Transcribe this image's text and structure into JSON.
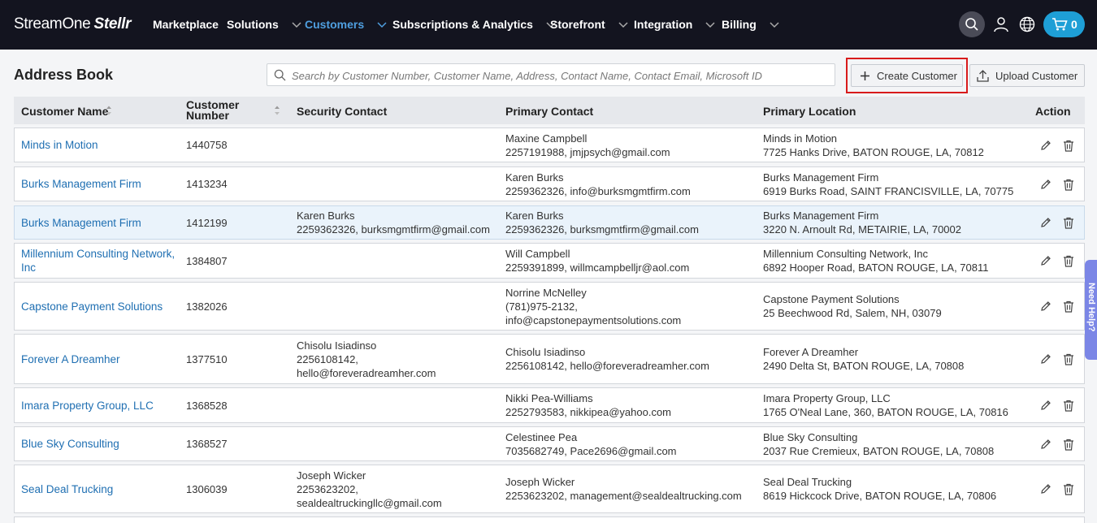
{
  "nav": {
    "brand_main": "StreamOne",
    "brand_sub": "Stellr",
    "items": [
      {
        "label": "Marketplace",
        "has_menu": false
      },
      {
        "label": "Solutions",
        "has_menu": true
      },
      {
        "label": "Customers",
        "has_menu": true,
        "active": true
      },
      {
        "label": "Subscriptions & Analytics",
        "has_menu": true
      },
      {
        "label": "Storefront",
        "has_menu": true
      },
      {
        "label": "Integration",
        "has_menu": true
      },
      {
        "label": "Billing",
        "has_menu": true
      }
    ],
    "cart_count": "0",
    "icons": [
      "search-icon",
      "user-icon",
      "globe-icon",
      "cart-icon"
    ]
  },
  "page": {
    "title": "Address Book",
    "search_placeholder": "Search by Customer Number, Customer Name, Address, Contact Name, Contact Email, Microsoft ID",
    "create_label": "Create Customer",
    "upload_label": "Upload Customer"
  },
  "table": {
    "columns": {
      "name": "Customer Name",
      "number_l1": "Customer",
      "number_l2": "Number",
      "security": "Security Contact",
      "primary": "Primary Contact",
      "location": "Primary Location",
      "action": "Action"
    },
    "rows": [
      {
        "name": [
          "Minds in Motion"
        ],
        "number": "1440758",
        "security": [],
        "primary": [
          "Maxine Campbell",
          "2257191988, jmjpsych@gmail.com"
        ],
        "location": [
          "Minds in Motion",
          "7725 Hanks Drive, BATON ROUGE, LA, 70812"
        ]
      },
      {
        "name": [
          "Burks Management Firm"
        ],
        "number": "1413234",
        "security": [],
        "primary": [
          "Karen Burks",
          "2259362326, info@burksmgmtfirm.com"
        ],
        "location": [
          "Burks Management Firm",
          "6919 Burks Road, SAINT FRANCISVILLE, LA, 70775"
        ]
      },
      {
        "name": [
          "Burks Management Firm"
        ],
        "number": "1412199",
        "security": [
          "Karen Burks",
          "2259362326, burksmgmtfirm@gmail.com"
        ],
        "primary": [
          "Karen Burks",
          "2259362326, burksmgmtfirm@gmail.com"
        ],
        "location": [
          "Burks Management Firm",
          "3220 N. Arnoult Rd, METAIRIE, LA, 70002"
        ],
        "selected": true
      },
      {
        "name": [
          "Millennium Consulting Network,",
          "Inc"
        ],
        "number": "1384807",
        "security": [],
        "primary": [
          "Will Campbell",
          "2259391899, willmcampbelljr@aol.com"
        ],
        "location": [
          "Millennium Consulting Network, Inc",
          "6892 Hooper Road, BATON ROUGE, LA, 70811"
        ]
      },
      {
        "name": [
          "Capstone Payment Solutions"
        ],
        "number": "1382026",
        "security": [],
        "primary": [
          "Norrine McNelley",
          "(781)975-2132,",
          "info@capstonepaymentsolutions.com"
        ],
        "location": [
          "Capstone Payment Solutions",
          "25 Beechwood Rd, Salem, NH, 03079"
        ]
      },
      {
        "name": [
          "Forever A Dreamher"
        ],
        "number": "1377510",
        "security": [
          "Chisolu Isiadinso",
          "2256108142,",
          "hello@foreveradreamher.com"
        ],
        "primary": [
          "Chisolu Isiadinso",
          "2256108142, hello@foreveradreamher.com"
        ],
        "location": [
          "Forever A Dreamher",
          "2490 Delta St, BATON ROUGE, LA, 70808"
        ]
      },
      {
        "name": [
          "Imara Property Group, LLC"
        ],
        "number": "1368528",
        "security": [],
        "primary": [
          "Nikki Pea-Williams",
          "2252793583, nikkipea@yahoo.com"
        ],
        "location": [
          "Imara Property Group, LLC",
          "1765 O'Neal Lane, 360, BATON ROUGE, LA, 70816"
        ]
      },
      {
        "name": [
          "Blue Sky Consulting"
        ],
        "number": "1368527",
        "security": [],
        "primary": [
          "Celestinee Pea",
          "7035682749, Pace2696@gmail.com"
        ],
        "location": [
          "Blue Sky Consulting",
          "2037 Rue Cremieux, BATON ROUGE, LA, 70808"
        ]
      },
      {
        "name": [
          "Seal Deal Trucking"
        ],
        "number": "1306039",
        "security": [
          "Joseph Wicker",
          "2253623202,",
          "sealdealtruckingllc@gmail.com"
        ],
        "primary": [
          "Joseph Wicker",
          "2253623202, management@sealdealtrucking.com"
        ],
        "location": [
          "Seal Deal Trucking",
          "8619 Hickcock Drive, BATON ROUGE, LA, 70806"
        ]
      }
    ]
  },
  "help": {
    "label": "Need Help?"
  },
  "colors": {
    "nav_bg": "#13141f",
    "active": "#4f9fe0",
    "link": "#1f6fb2",
    "cart": "#1e9fd6",
    "highlight": "#d81b1b",
    "help": "#7b86e6"
  }
}
